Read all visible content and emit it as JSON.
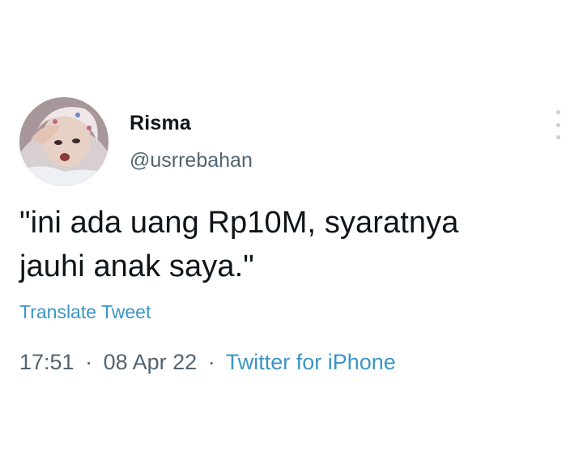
{
  "tweet": {
    "author": {
      "display_name": "Risma",
      "handle": "@usrrebahan",
      "avatar_icon": "profile-photo"
    },
    "more_icon": "more-vertical-icon",
    "text": "\"ini ada uang Rp10M, syaratnya\njauhi anak saya.\"",
    "translate_label": "Translate Tweet",
    "time": "17:51",
    "separator": "·",
    "date": "08 Apr 22",
    "source": "Twitter for iPhone"
  },
  "colors": {
    "text": "#0f1419",
    "secondary": "#536471",
    "link": "#3b95c4"
  }
}
